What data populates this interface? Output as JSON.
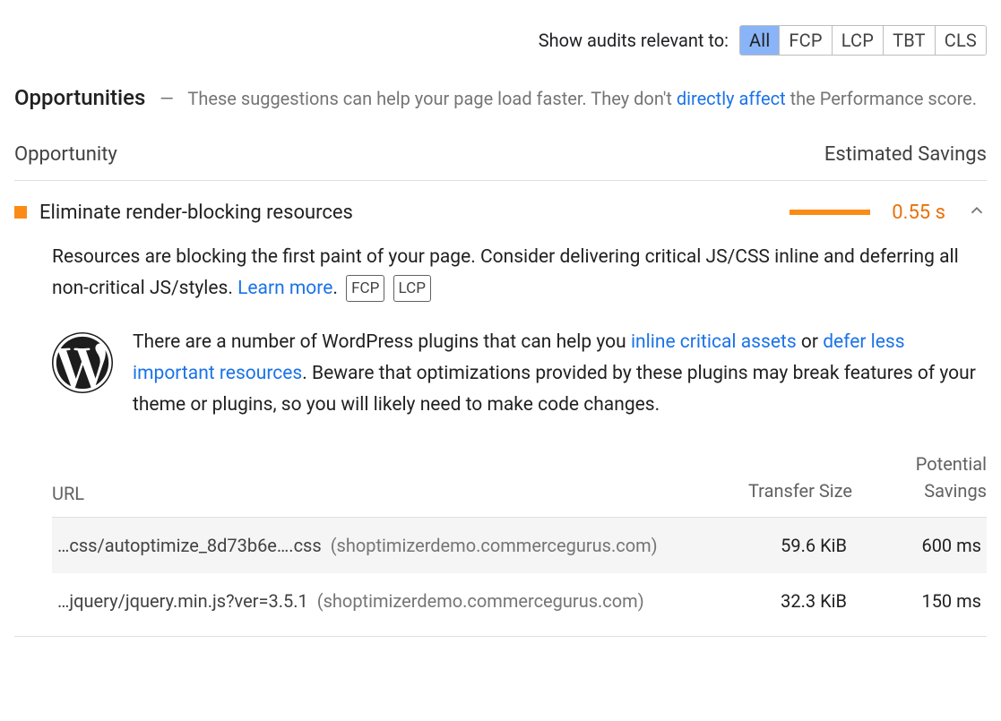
{
  "filter": {
    "label": "Show audits relevant to:",
    "buttons": [
      "All",
      "FCP",
      "LCP",
      "TBT",
      "CLS"
    ],
    "active": "All"
  },
  "section": {
    "title": "Opportunities",
    "dash": "—",
    "desc_before": "These suggestions can help your page load faster. They don't ",
    "link_text": "directly affect",
    "desc_after": " the Performance score."
  },
  "table_head": {
    "left": "Opportunity",
    "right": "Estimated Savings"
  },
  "audit": {
    "title": "Eliminate render-blocking resources",
    "savings": "0.55 s",
    "desc_before": "Resources are blocking the first paint of your page. Consider delivering critical JS/CSS inline and deferring all non-critical JS/styles. ",
    "learn_more": "Learn more",
    "desc_after": ".",
    "chips": [
      "FCP",
      "LCP"
    ],
    "wp": {
      "t1": "There are a number of WordPress plugins that can help you ",
      "link1": "inline critical assets",
      "t2": " or ",
      "link2": "defer less important resources",
      "t3": ". Beware that optimizations provided by these plugins may break features of your theme or plugins, so you will likely need to make code changes."
    }
  },
  "resources": {
    "headers": {
      "url": "URL",
      "size": "Transfer Size",
      "savings": "Potential Savings"
    },
    "rows": [
      {
        "path": "…css/autoptimize_8d73b6e….css",
        "host": "(shoptimizerdemo.commercegurus.com)",
        "size": "59.6 KiB",
        "savings": "600 ms"
      },
      {
        "path": "…jquery/jquery.min.js?ver=3.5.1",
        "host": "(shoptimizerdemo.commercegurus.com)",
        "size": "32.3 KiB",
        "savings": "150 ms"
      }
    ]
  }
}
